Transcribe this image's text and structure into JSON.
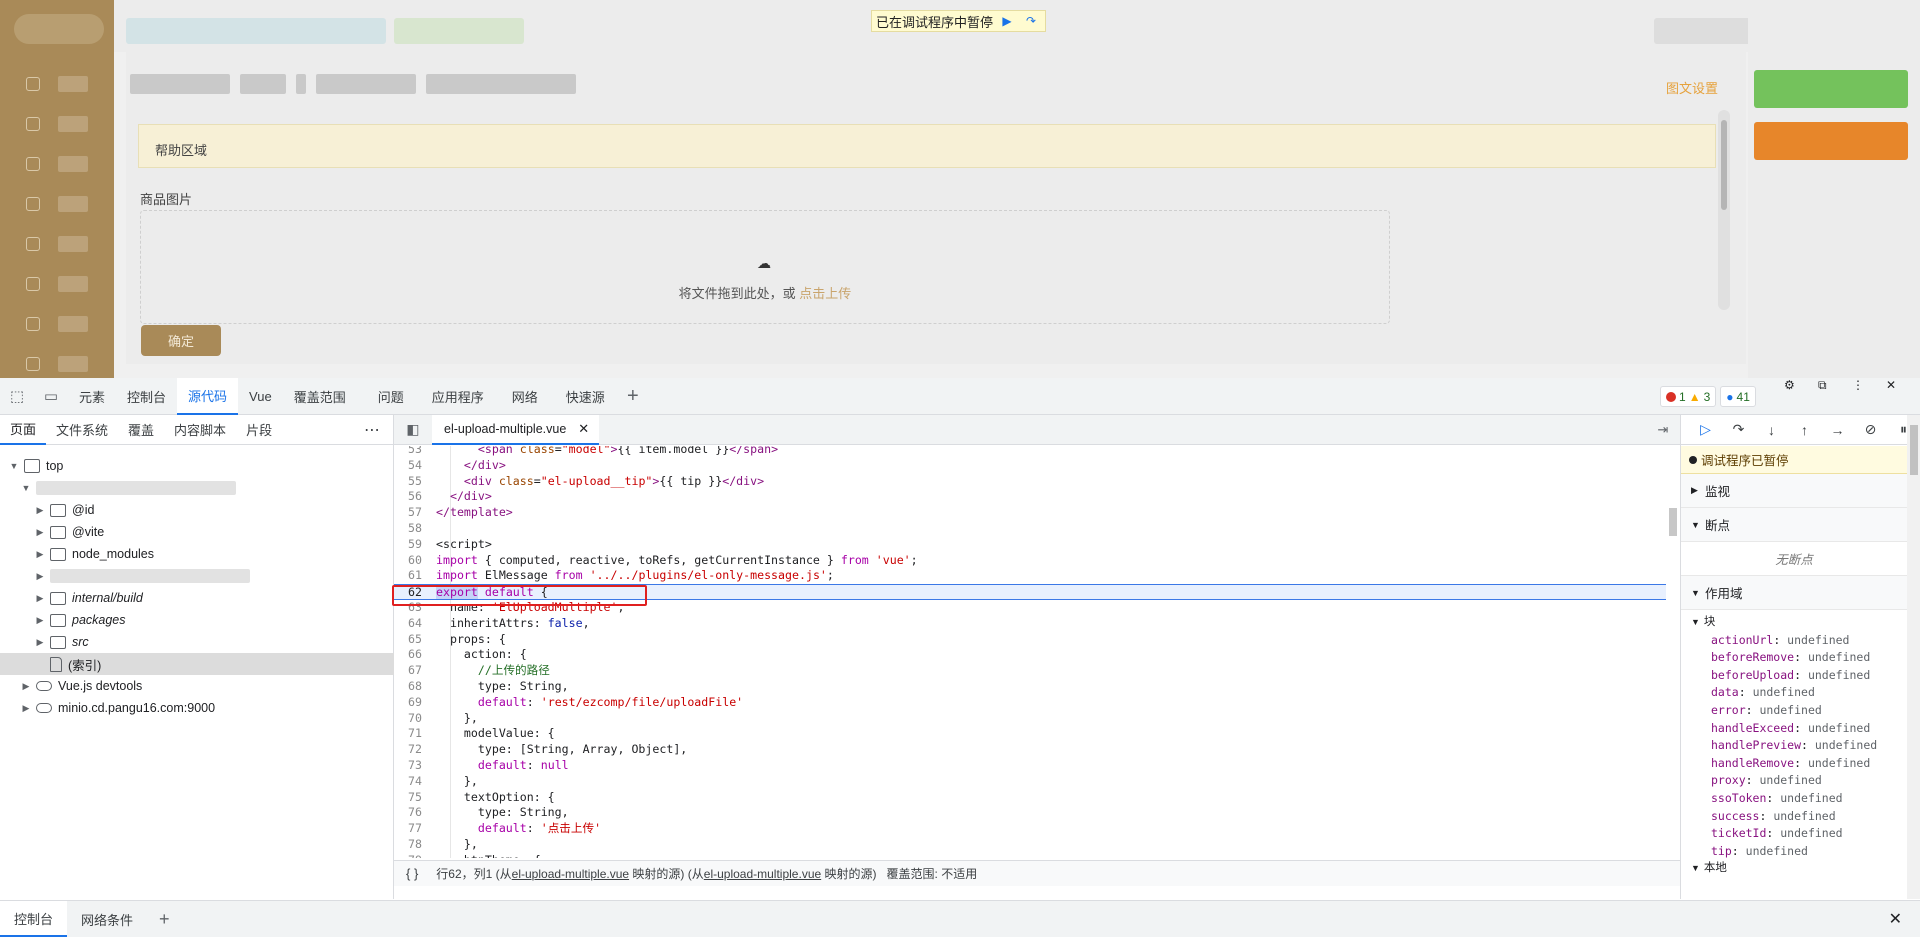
{
  "page": {
    "pause_banner": {
      "text": "已在调试程序中暂停",
      "resume_icon": "resume-icon",
      "step_icon": "step-over-icon"
    },
    "image_text_settings": "图文设置",
    "help_area": "帮助区域",
    "product_image_label": "商品图片",
    "upload": {
      "text": "将文件拖到此处，或 ",
      "link": "点击上传"
    },
    "confirm_button": "确定"
  },
  "devtools": {
    "tabs": [
      "元素",
      "控制台",
      "源代码",
      "Vue",
      "覆盖范围",
      "问题",
      "应用程序",
      "网络",
      "快速源"
    ],
    "active_tab": "源代码",
    "counters": {
      "errors": "1",
      "warnings": "3",
      "messages": "41"
    },
    "navigator": {
      "tabs": [
        "页面",
        "文件系统",
        "覆盖",
        "内容脚本",
        "片段"
      ],
      "tree": {
        "top": "top",
        "id": "@id",
        "vite": "@vite",
        "node_modules": "node_modules",
        "internal_build": "internal/build",
        "packages": "packages",
        "src": "src",
        "index": "(索引)",
        "vue_devtools": "Vue.js devtools",
        "minio": "minio.cd.pangu16.com:9000"
      }
    },
    "editor": {
      "file_tab": "el-upload-multiple.vue",
      "status": {
        "braces": "{ }",
        "position": "行62，列1",
        "src1_pre": "(从",
        "src1_file": "el-upload-multiple.vue",
        "src1_post": "映射的源)",
        "src2_pre": "(从",
        "src2_file": "el-upload-multiple.vue",
        "src2_post": "映射的源)",
        "coverage": "覆盖范围: 不适用"
      }
    },
    "debugger": {
      "paused": "调试程序已暂停",
      "watch": "监视",
      "breakpoints": "断点",
      "no_breakpoints": "无断点",
      "scope": "作用域",
      "block": "块",
      "local": "本地",
      "vars": [
        {
          "k": "actionUrl",
          "v": "undefined"
        },
        {
          "k": "beforeRemove",
          "v": "undefined"
        },
        {
          "k": "beforeUpload",
          "v": "undefined"
        },
        {
          "k": "data",
          "v": "undefined"
        },
        {
          "k": "error",
          "v": "undefined"
        },
        {
          "k": "handleExceed",
          "v": "undefined"
        },
        {
          "k": "handlePreview",
          "v": "undefined"
        },
        {
          "k": "handleRemove",
          "v": "undefined"
        },
        {
          "k": "proxy",
          "v": "undefined"
        },
        {
          "k": "ssoToken",
          "v": "undefined"
        },
        {
          "k": "success",
          "v": "undefined"
        },
        {
          "k": "ticketId",
          "v": "undefined"
        },
        {
          "k": "tip",
          "v": "undefined"
        }
      ]
    },
    "drawer": {
      "tabs": [
        "控制台",
        "网络条件"
      ]
    }
  }
}
